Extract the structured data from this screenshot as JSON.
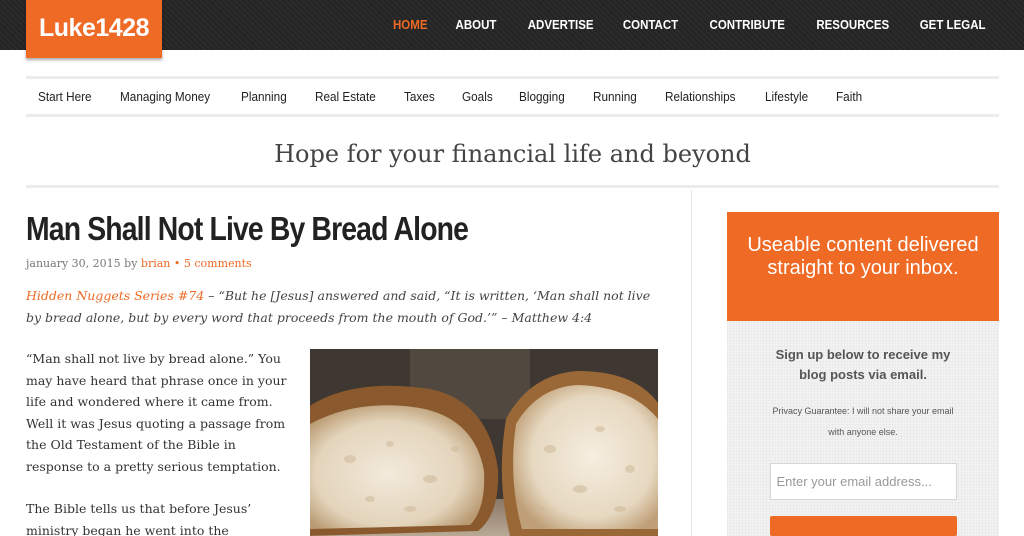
{
  "site": {
    "logo": "Luke1428"
  },
  "top_nav": [
    "HOME",
    "ABOUT",
    "ADVERTISE",
    "CONTACT",
    "CONTRIBUTE",
    "RESOURCES",
    "GET LEGAL"
  ],
  "top_nav_active": "HOME",
  "categories": [
    "Start Here",
    "Managing Money",
    "Planning",
    "Real Estate",
    "Taxes",
    "Goals",
    "Blogging",
    "Running",
    "Relationships",
    "Lifestyle",
    "Faith"
  ],
  "tagline": "Hope for your financial life and beyond",
  "post": {
    "title": "Man Shall Not Live By Bread Alone",
    "date": "january 30, 2015",
    "by": "by",
    "author": "brian",
    "sep": "•",
    "comments": "5 comments",
    "series": "Hidden Nuggets Series #74",
    "dash": " – ",
    "verse": "“But he [Jesus] answered and said, “It is written, ‘Man shall not live by bread alone, but by every word that proceeds from the mouth of God.’” – Matthew 4:4",
    "paragraph_1": "“Man shall not live by bread alone.” You may have heard that phrase once in your life and wondered where it came from. Well it was Jesus quoting a passage from the Old Testament of the Bible in response to a pretty serious temptation.",
    "paragraph_2": "The Bible tells us that before Jesus’ ministry began he went into the"
  },
  "optin": {
    "headline": "Useable content delivered straight to your inbox.",
    "subhead": "Sign up below to receive my blog posts via email.",
    "privacy": "Privacy Guarantee: I will not share your email with anyone else.",
    "email_placeholder": "Enter your email address..."
  },
  "colors": {
    "accent": "#ee6a25",
    "topbar": "#2b2b2b"
  }
}
